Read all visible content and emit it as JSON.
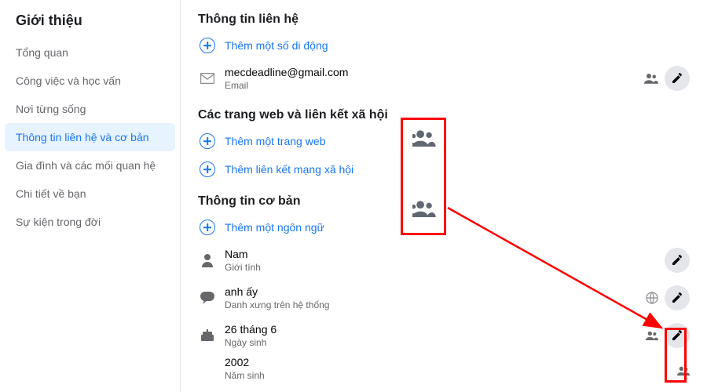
{
  "sidebar": {
    "title": "Giới thiệu",
    "items": [
      {
        "label": "Tổng quan"
      },
      {
        "label": "Công việc và học vấn"
      },
      {
        "label": "Nơi từng sống"
      },
      {
        "label": "Thông tin liên hệ và cơ bản"
      },
      {
        "label": "Gia đình và các mối quan hệ"
      },
      {
        "label": "Chi tiết về bạn"
      },
      {
        "label": "Sự kiện trong đời"
      }
    ],
    "active_index": 3
  },
  "sections": {
    "contact": {
      "title": "Thông tin liên hệ",
      "add_mobile": "Thêm một số di động",
      "email_value": "mecdeadline@gmail.com",
      "email_label": "Email"
    },
    "web": {
      "title": "Các trang web và liên kết xã hội",
      "add_website": "Thêm một trang web",
      "add_social": "Thêm liên kết mạng xã hội"
    },
    "basic": {
      "title": "Thông tin cơ bản",
      "add_language": "Thêm một ngôn ngữ",
      "gender_value": "Nam",
      "gender_label": "Giới tính",
      "pronoun_value": "anh ấy",
      "pronoun_label": "Danh xưng trên hệ thống",
      "birth_day_value": "26 tháng 6",
      "birth_day_label": "Ngày sinh",
      "birth_year_value": "2002",
      "birth_year_label": "Năm sinh"
    }
  },
  "icons": {
    "friends": "friends-icon",
    "globe": "globe-icon",
    "pencil": "pencil-icon",
    "envelope": "envelope-icon",
    "person": "person-icon",
    "speech": "speech-icon",
    "cake": "cake-icon"
  }
}
